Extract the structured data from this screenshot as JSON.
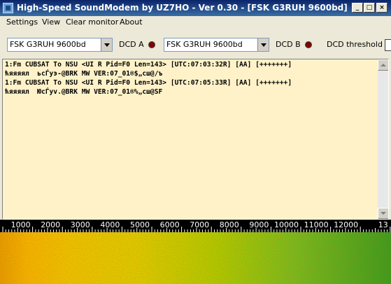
{
  "window": {
    "title": "High-Speed SoundModem by UZ7HO - Ver 0.30 - [FSK G3RUH 9600bd]"
  },
  "menu": {
    "items": [
      "Settings",
      "View",
      "Clear monitor",
      "About"
    ]
  },
  "toolbar": {
    "channel_a": {
      "modem": "FSK G3RUH 9600bd",
      "dcd_label": "DCD A"
    },
    "channel_b": {
      "modem": "FSK G3RUH 9600bd",
      "dcd_label": "DCD B"
    },
    "dcd_threshold_label": "DCD threshold"
  },
  "monitor": {
    "lines": [
      "1:Fm CUBSAT To NSU <UI R Pid=F0 Len=143> [UTC:07:03:32R] [AA] [+++++++]",
      "ћяяяял  ьсЃуэ-@BRK MW VER:07_01®$„сш@/ъ",
      "1:Fm CUBSAT To NSU <UI R Pid=F0 Len=143> [UTC:07:05:33R] [AA] [+++++++]",
      "ћяяяял  ЮсЃуv.@BRK MW VER:07_01®%„сш@SF"
    ]
  },
  "waterfall": {
    "freq_labels": [
      "1000",
      "2000",
      "3000",
      "4000",
      "5000",
      "6000",
      "7000",
      "8000",
      "9000",
      "10000",
      "11000",
      "12000",
      "13"
    ]
  },
  "colors": {
    "led_off": "#800000",
    "monitor_bg": "#fff2c9",
    "title_start": "#0a246a",
    "title_end": "#3a6ea5"
  }
}
